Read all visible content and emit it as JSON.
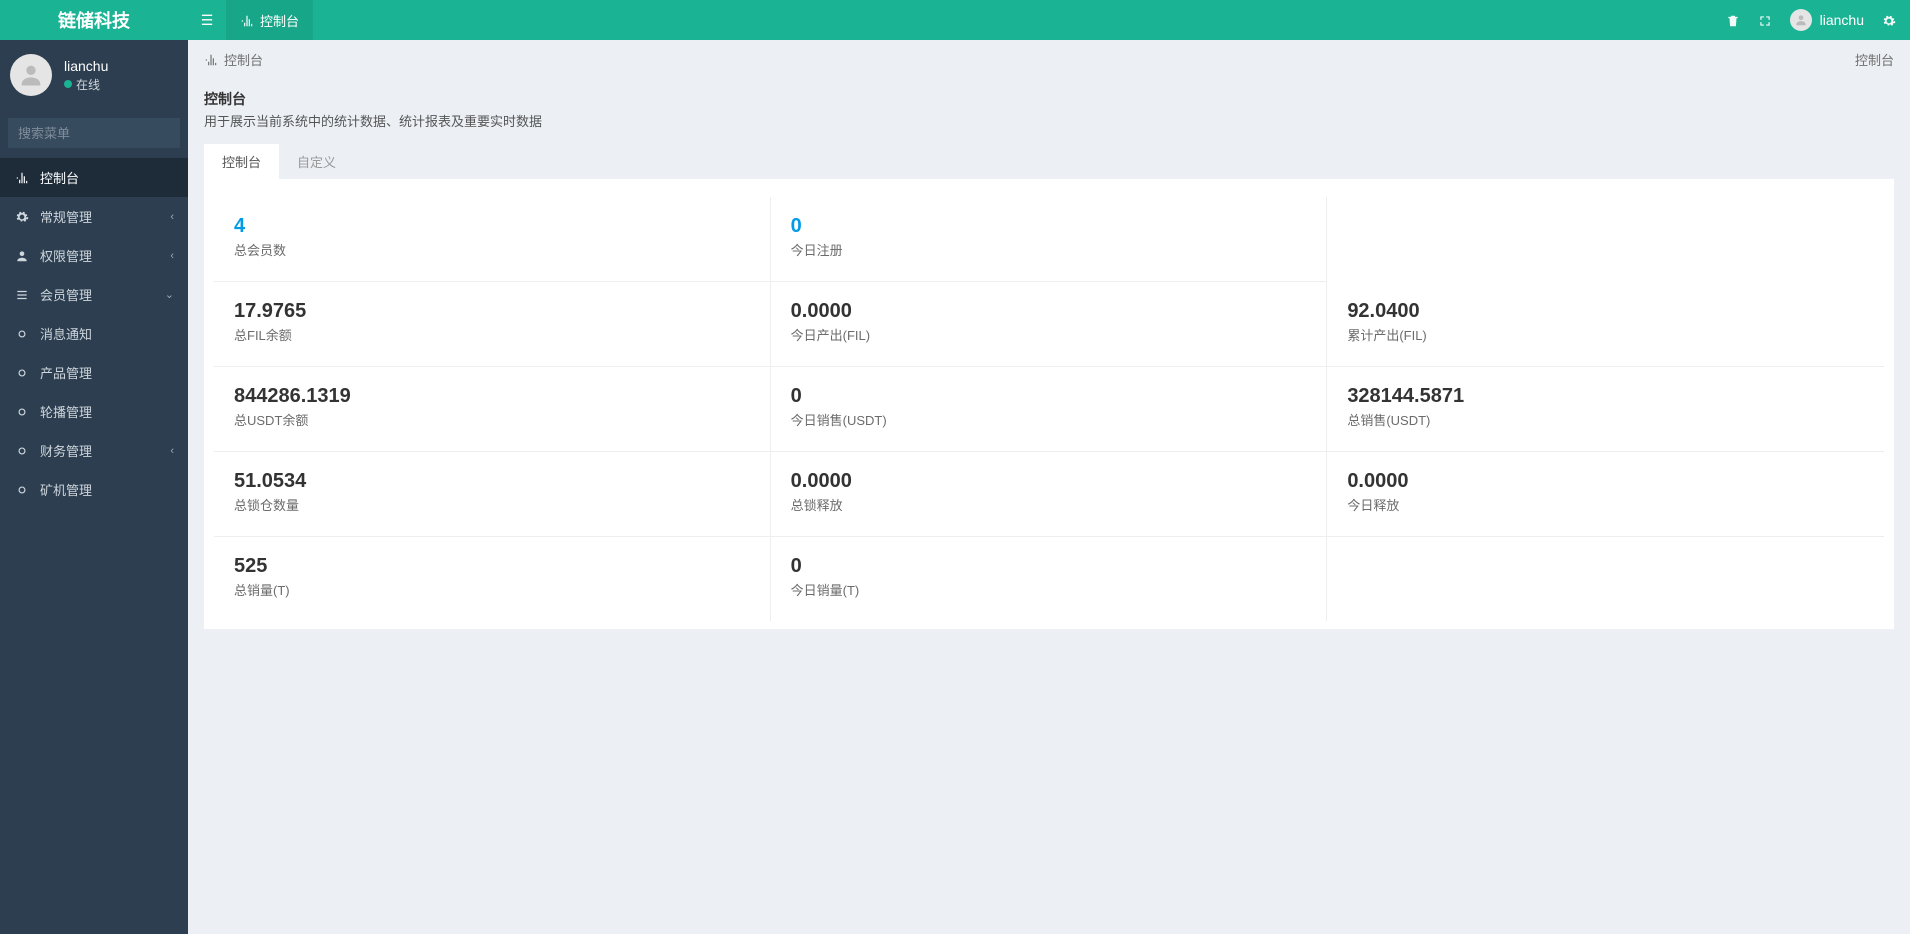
{
  "header": {
    "logo": "链储科技",
    "tab_label": "控制台",
    "username": "lianchu"
  },
  "sidebar": {
    "username": "lianchu",
    "status": "在线",
    "search_placeholder": "搜索菜单",
    "nav": [
      {
        "label": "控制台"
      },
      {
        "label": "常规管理"
      },
      {
        "label": "权限管理"
      },
      {
        "label": "会员管理"
      },
      {
        "label": "消息通知"
      },
      {
        "label": "产品管理"
      },
      {
        "label": "轮播管理"
      },
      {
        "label": "财务管理"
      },
      {
        "label": "矿机管理"
      }
    ]
  },
  "breadcrumb": {
    "left": "控制台",
    "right": "控制台"
  },
  "panel": {
    "title": "控制台",
    "desc": "用于展示当前系统中的统计数据、统计报表及重要实时数据",
    "tabs": [
      {
        "label": "控制台"
      },
      {
        "label": "自定义"
      }
    ]
  },
  "stats": {
    "row1": {
      "c1": {
        "value": "4",
        "label": "总会员数"
      },
      "c2": {
        "value": "0",
        "label": "今日注册"
      }
    },
    "row2": {
      "c1": {
        "value": "17.9765",
        "label": "总FIL余额"
      },
      "c2": {
        "value": "0.0000",
        "label": "今日产出(FIL)"
      },
      "c3": {
        "value": "92.0400",
        "label": "累计产出(FIL)"
      }
    },
    "row3": {
      "c1": {
        "value": "844286.1319",
        "label": "总USDT余额"
      },
      "c2": {
        "value": "0",
        "label": "今日销售(USDT)"
      },
      "c3": {
        "value": "328144.5871",
        "label": "总销售(USDT)"
      }
    },
    "row4": {
      "c1": {
        "value": "51.0534",
        "label": "总锁仓数量"
      },
      "c2": {
        "value": "0.0000",
        "label": "总锁释放"
      },
      "c3": {
        "value": "0.0000",
        "label": "今日释放"
      }
    },
    "row5": {
      "c1": {
        "value": "525",
        "label": "总销量(T)"
      },
      "c2": {
        "value": "0",
        "label": "今日销量(T)"
      }
    }
  }
}
